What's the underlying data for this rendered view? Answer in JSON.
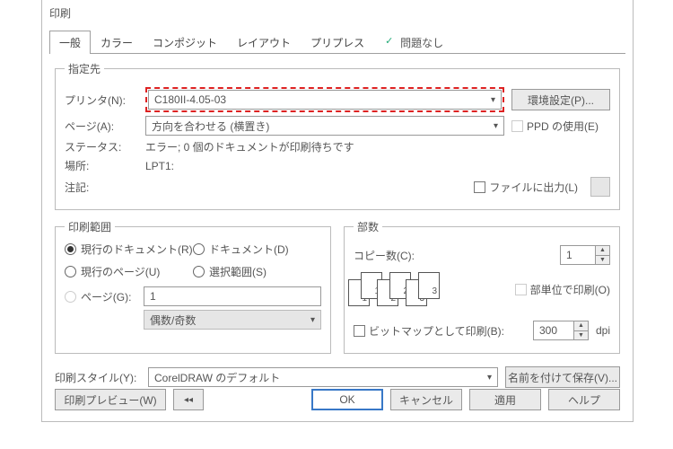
{
  "title": "印刷",
  "tabs": [
    "一般",
    "カラー",
    "コンポジット",
    "レイアウト",
    "プリプレス",
    "問題なし"
  ],
  "dest": {
    "legend": "指定先",
    "printer_lbl": "プリンタ(N):",
    "printer": "C180II-4.05-03",
    "envset": "環境設定(P)...",
    "page_lbl": "ページ(A):",
    "page": "方向を合わせる (横置き)",
    "ppd": "PPD の使用(E)",
    "status_lbl": "ステータス:",
    "status": "エラー; 0 個のドキュメントが印刷待ちです",
    "loc_lbl": "場所:",
    "loc": "LPT1:",
    "note_lbl": "注記:",
    "tofile": "ファイルに出力(L)"
  },
  "range": {
    "legend": "印刷範囲",
    "curdoc": "現行のドキュメント(R)",
    "docs": "ドキュメント(D)",
    "curpage": "現行のページ(U)",
    "selrange": "選択範囲(S)",
    "pages_lbl": "ページ(G):",
    "pages_val": "1",
    "oddeven": "偶数/奇数"
  },
  "copies": {
    "legend": "部数",
    "copy_lbl": "コピー数(C):",
    "copy_val": "1",
    "perunit": "部単位で印刷(O)",
    "bitmap": "ビットマップとして印刷(B):",
    "dpi_val": "300",
    "dpi": "dpi"
  },
  "style": {
    "lbl": "印刷スタイル(Y):",
    "val": "CorelDRAW のデフォルト",
    "saveas": "名前を付けて保存(V)..."
  },
  "footer": {
    "preview": "印刷プレビュー(W)",
    "ok": "OK",
    "cancel": "キャンセル",
    "apply": "適用",
    "help": "ヘルプ"
  }
}
